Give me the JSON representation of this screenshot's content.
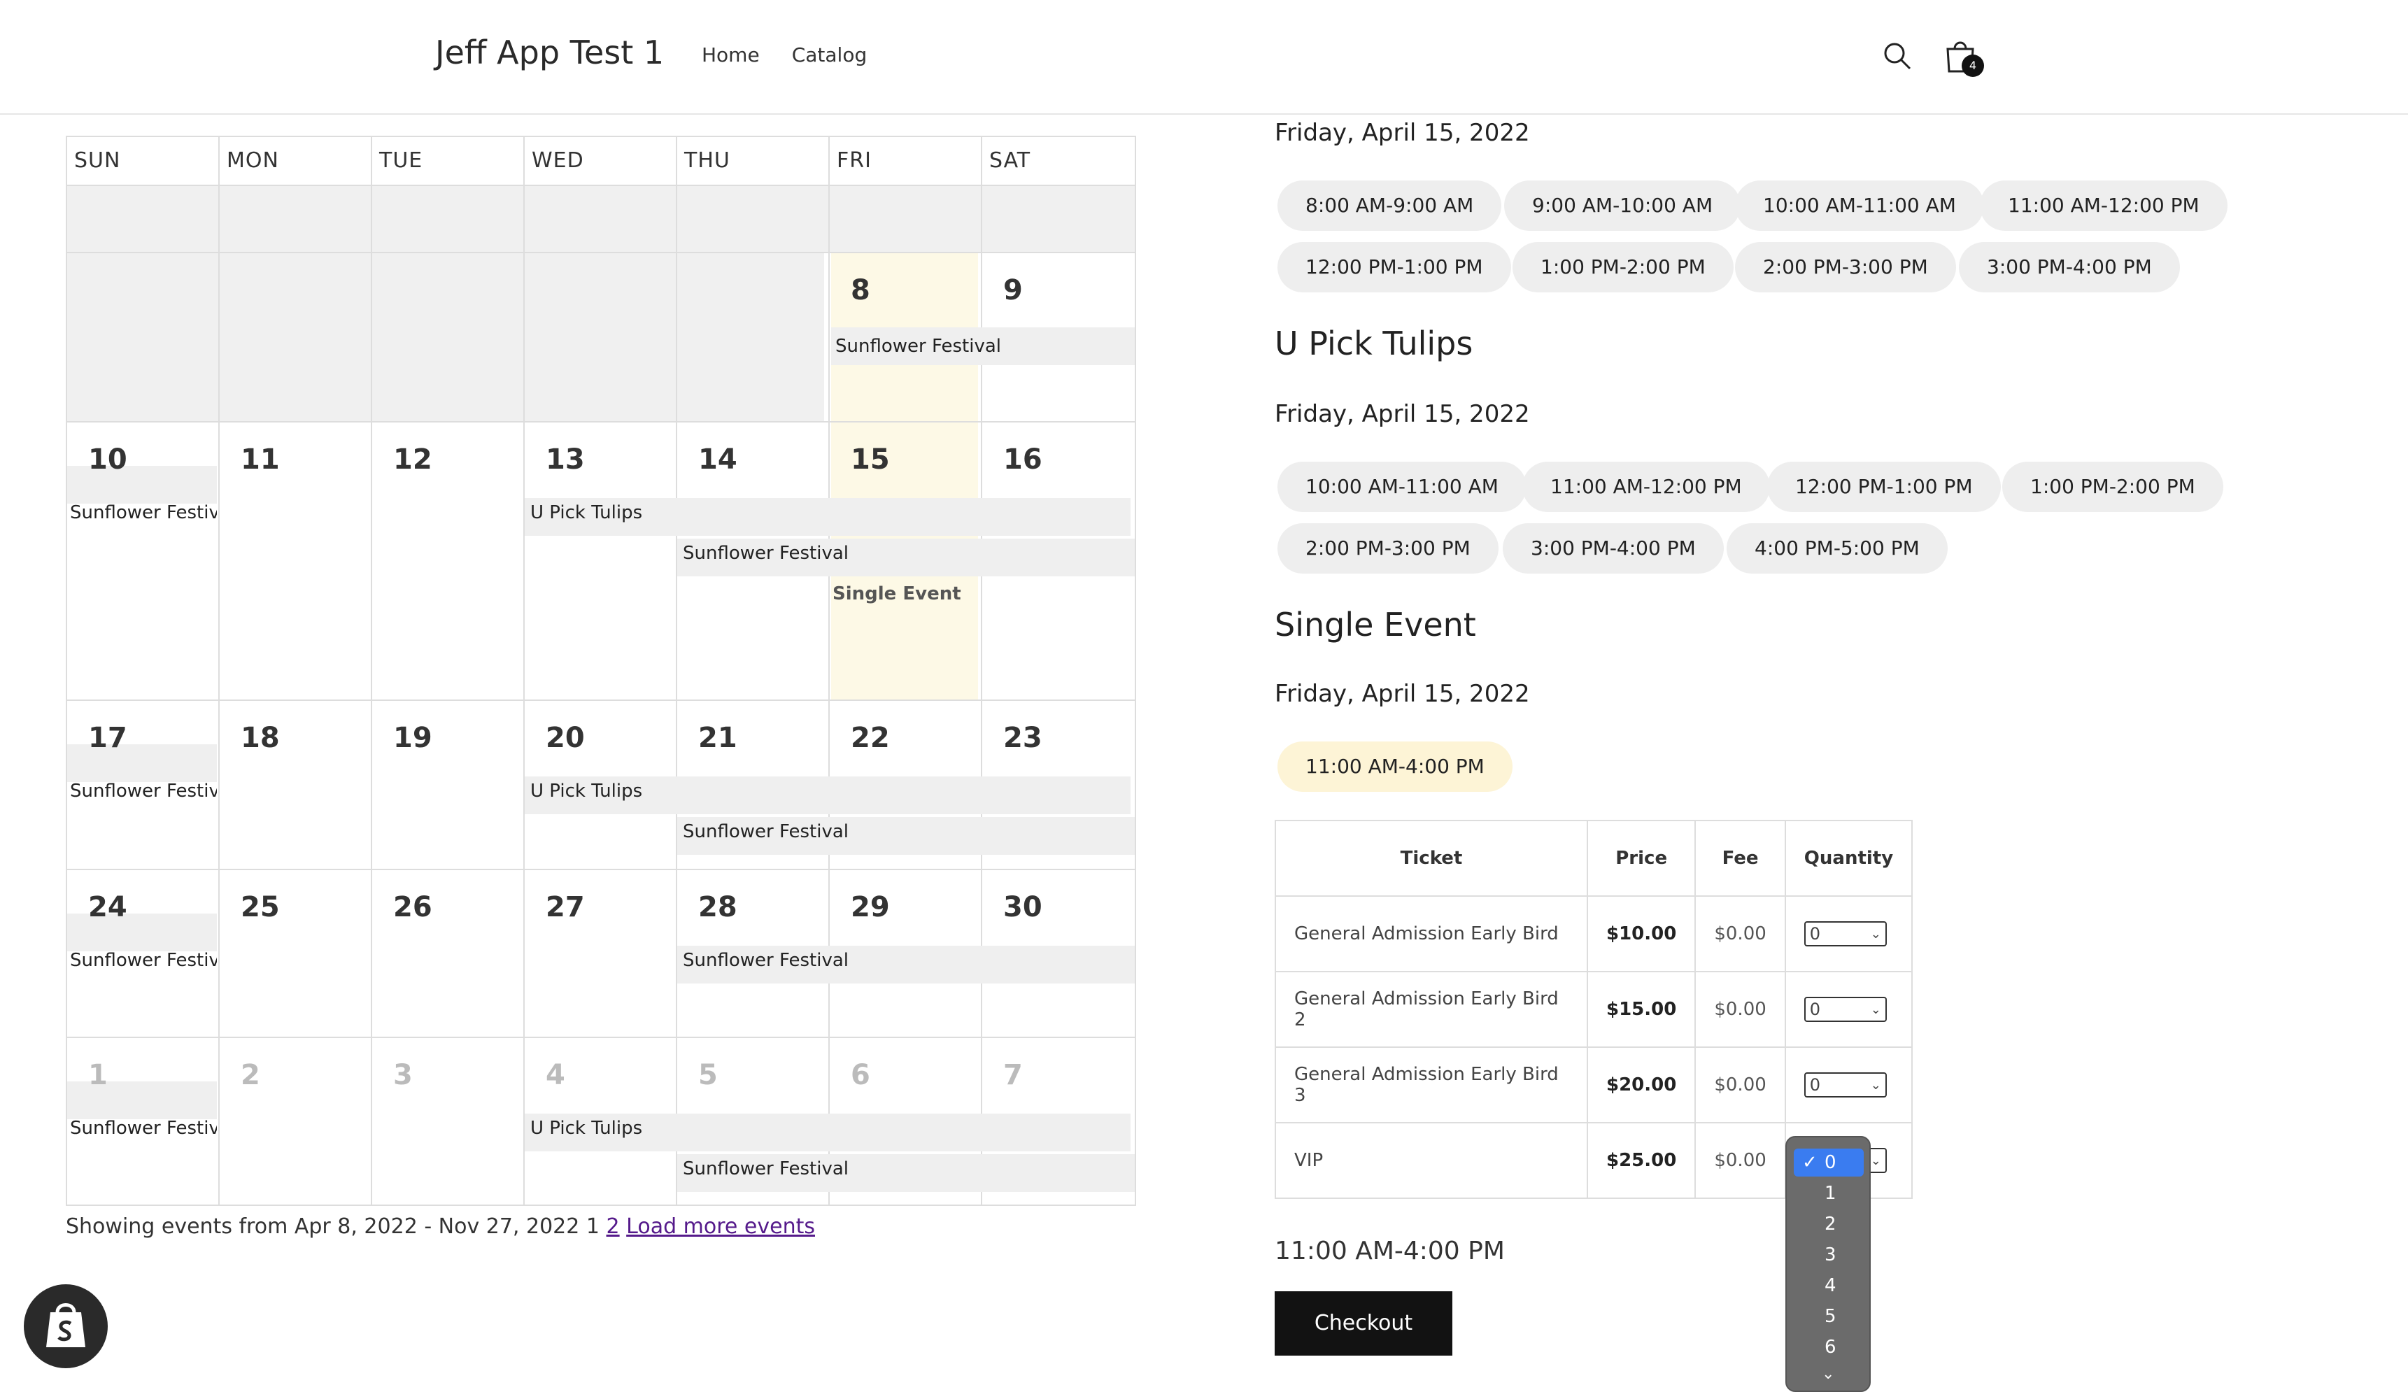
{
  "header": {
    "brand": "Jeff App Test 1",
    "nav": [
      "Home",
      "Catalog"
    ],
    "cart_count": "4"
  },
  "calendar": {
    "days_of_week": [
      "SUN",
      "MON",
      "TUE",
      "WED",
      "THU",
      "FRI",
      "SAT"
    ],
    "weeks": [
      [
        "",
        "",
        "",
        "",
        "",
        "",
        ""
      ],
      [
        "",
        "",
        "",
        "",
        "",
        "8",
        "9"
      ],
      [
        "10",
        "11",
        "12",
        "13",
        "14",
        "15",
        "16"
      ],
      [
        "17",
        "18",
        "19",
        "20",
        "21",
        "22",
        "23"
      ],
      [
        "24",
        "25",
        "26",
        "27",
        "28",
        "29",
        "30"
      ],
      [
        "1",
        "2",
        "3",
        "4",
        "5",
        "6",
        "7"
      ]
    ],
    "events": {
      "sunflower": "Sunflower Festival",
      "sunflower_short": "Sunflower Festiva",
      "tulips": "U Pick Tulips",
      "single": "Single Event"
    },
    "showing_text": "Showing events from Apr 8, 2022 - Nov 27, 2022 1",
    "page_2": "2",
    "load_more": "Load more events"
  },
  "sections": {
    "first_date": "Friday, April 15, 2022",
    "first_slots": [
      "8:00 AM-9:00 AM",
      "9:00 AM-10:00 AM",
      "10:00 AM-11:00 AM",
      "11:00 AM-12:00 PM",
      "12:00 PM-1:00 PM",
      "1:00 PM-2:00 PM",
      "2:00 PM-3:00 PM",
      "3:00 PM-4:00 PM"
    ],
    "tulips_title": "U Pick Tulips",
    "tulips_date": "Friday, April 15, 2022",
    "tulips_slots": [
      "10:00 AM-11:00 AM",
      "11:00 AM-12:00 PM",
      "12:00 PM-1:00 PM",
      "1:00 PM-2:00 PM",
      "2:00 PM-3:00 PM",
      "3:00 PM-4:00 PM",
      "4:00 PM-5:00 PM"
    ],
    "single_title": "Single Event",
    "single_date": "Friday, April 15, 2022",
    "single_slot": "11:00 AM-4:00 PM"
  },
  "tickets": {
    "headers": [
      "Ticket",
      "Price",
      "Fee",
      "Quantity"
    ],
    "rows": [
      {
        "name": "General Admission Early Bird",
        "price": "$10.00",
        "fee": "$0.00",
        "qty": "0"
      },
      {
        "name": "General Admission Early Bird 2",
        "price": "$15.00",
        "fee": "$0.00",
        "qty": "0"
      },
      {
        "name": "General Admission Early Bird 3",
        "price": "$20.00",
        "fee": "$0.00",
        "qty": "0"
      },
      {
        "name": "VIP",
        "price": "$25.00",
        "fee": "$0.00",
        "qty": "0"
      }
    ]
  },
  "summary_time": "11:00 AM-4:00 PM",
  "checkout_label": "Checkout",
  "dropdown": {
    "options": [
      "0",
      "1",
      "2",
      "3",
      "4",
      "5",
      "6"
    ],
    "selected": "0",
    "check": "✓"
  },
  "colors": {
    "accent_select": "#3a7cf0",
    "today_highlight": "#fdf9e6",
    "pill_selected": "#fdf4d6",
    "button": "#121212"
  }
}
